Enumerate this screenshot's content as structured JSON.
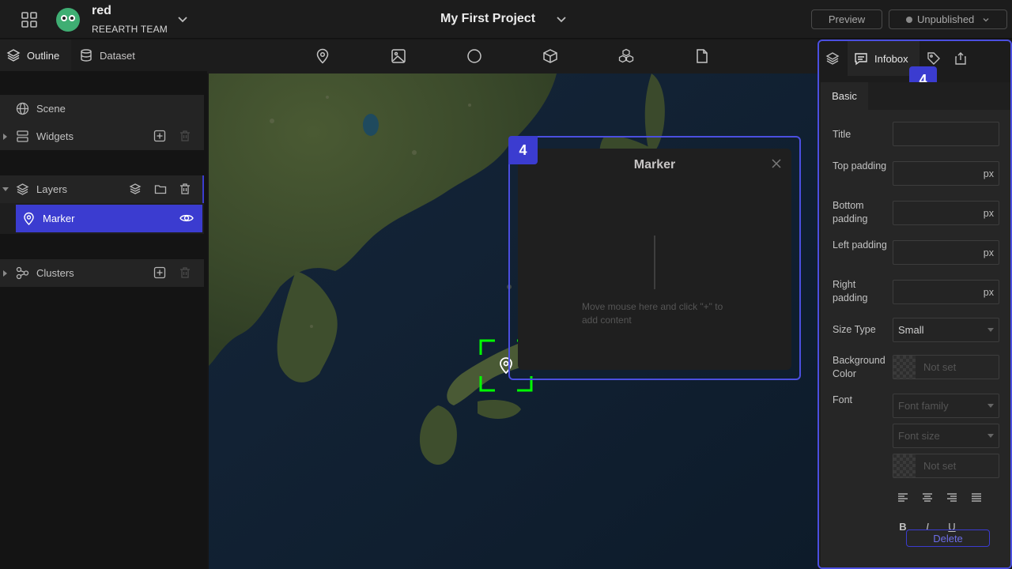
{
  "header": {
    "workspace_name": "red",
    "workspace_team": "REEARTH TEAM",
    "project_title": "My First Project",
    "preview_label": "Preview",
    "publish_label": "Unpublished"
  },
  "left_tabs": [
    {
      "label": "Outline",
      "icon": "layers-icon",
      "active": true
    },
    {
      "label": "Dataset",
      "icon": "database-icon",
      "active": false
    }
  ],
  "outline": {
    "scene": "Scene",
    "widgets": "Widgets",
    "layers": "Layers",
    "marker": "Marker",
    "clusters": "Clusters"
  },
  "toolbar": [
    "marker-tool-icon",
    "image-tool-icon",
    "circle-tool-icon",
    "box-tool-icon",
    "3d-model-tool-icon",
    "file-tool-icon"
  ],
  "infobox": {
    "badge": "4",
    "title": "Marker",
    "hint": "Move mouse here and click \"+\" to add content"
  },
  "right_panel": {
    "active_tab": "Infobox",
    "badge": "4",
    "subtab": "Basic",
    "fields": {
      "title": "Title",
      "top_padding": "Top padding",
      "bottom_padding": "Bottom padding",
      "left_padding": "Left padding",
      "right_padding": "Right padding",
      "unit": "px",
      "size_type_label": "Size Type",
      "size_type_value": "Small",
      "bg_color_label": "Background Color",
      "not_set": "Not set",
      "font_label": "Font",
      "font_family": "Font family",
      "font_size": "Font size",
      "bold": "B",
      "italic": "I",
      "underline": "U"
    },
    "delete_label": "Delete"
  },
  "colors": {
    "accent": "#3b3cd0",
    "target": "#00ff00"
  }
}
